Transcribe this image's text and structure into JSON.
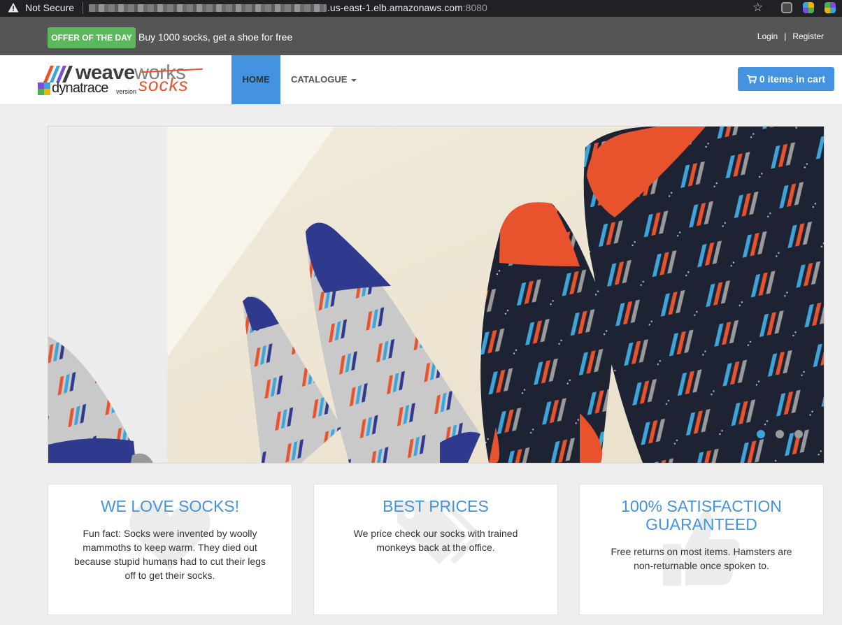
{
  "browser": {
    "security_label": "Not Secure",
    "host_suffix": ".us-east-1.elb.amazonaws.com",
    "port": ":8080"
  },
  "topbar": {
    "offer_badge": "OFFER OF THE DAY",
    "offer_text": "Buy 1000 socks, get a shoe for free",
    "login": "Login",
    "separator": "|",
    "register": "Register"
  },
  "navbar": {
    "logo": {
      "brand": "weave",
      "brand_suffix": "works",
      "partner": "dynatrace",
      "edition": "version",
      "product": "socks"
    },
    "home": "HOME",
    "catalogue": "CATALOGUE",
    "cart": "0 items in cart"
  },
  "hero": {
    "slides": 3,
    "active_slide": 1
  },
  "features": [
    {
      "title": "WE LOVE SOCKS!",
      "body": "Fun fact: Socks were invented by woolly mammoths to keep warm. They died out because stupid humans had to cut their legs off to get their socks.",
      "icon": "heart-icon"
    },
    {
      "title": "BEST PRICES",
      "body": "We price check our socks with trained monkeys back at the office.",
      "icon": "tags-icon"
    },
    {
      "title": "100% SATISFACTION GUARANTEED",
      "body": "Free returns on most items. Hamsters are non-returnable once spoken to.",
      "icon": "thumbs-up-icon"
    }
  ],
  "colors": {
    "accent": "#4493e0",
    "offer": "#5cb85c",
    "topbar": "#555555",
    "background": "#eeeeee"
  }
}
